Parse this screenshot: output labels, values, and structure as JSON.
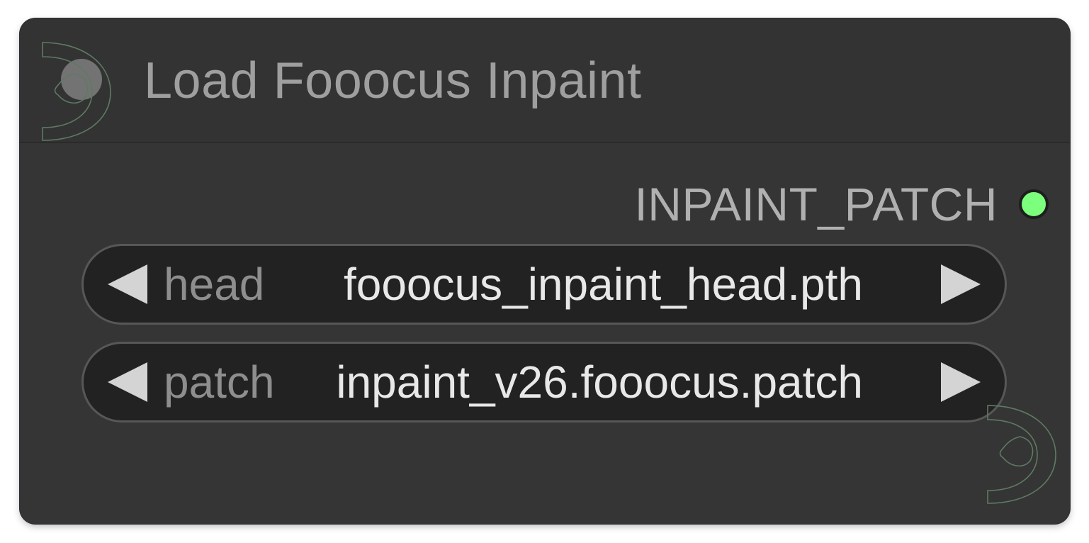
{
  "node": {
    "title": "Load Fooocus Inpaint",
    "output": {
      "label": "INPAINT_PATCH",
      "slot_color": "#7CFF7C"
    },
    "widgets": [
      {
        "label": "head",
        "value": "fooocus_inpaint_head.pth"
      },
      {
        "label": "patch",
        "value": "inpaint_v26.fooocus.patch"
      }
    ]
  },
  "colors": {
    "node_background": "#353535",
    "widget_background": "#222222",
    "title_text": "#9f9f9f",
    "value_text": "#e8e8e8"
  },
  "icons": [
    "collapse-dot-icon",
    "left-arrow-icon",
    "right-arrow-icon",
    "decorative-logo-icon"
  ]
}
